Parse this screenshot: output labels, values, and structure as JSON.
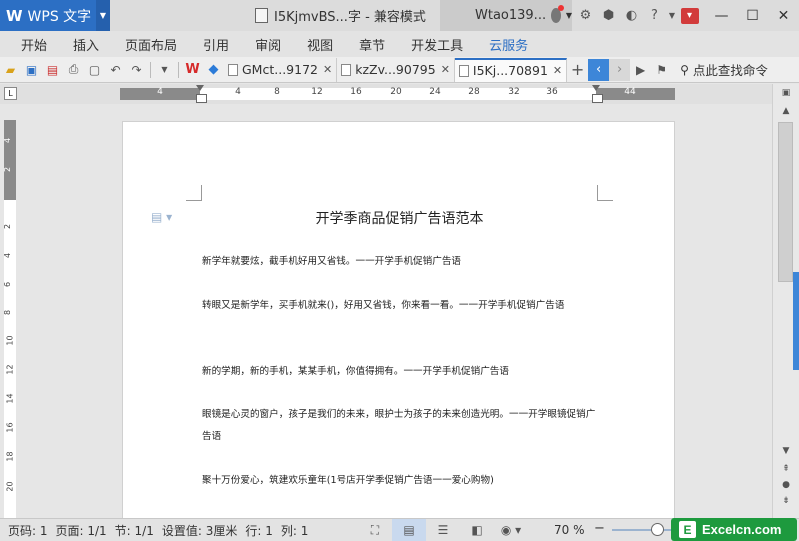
{
  "titlebar": {
    "app_logo": "W",
    "app_name": "WPS 文字",
    "doc_title": "I5KjmvBS...字 - 兼容模式",
    "user_name": "Wtao139..."
  },
  "menu": {
    "items": [
      "开始",
      "插入",
      "页面布局",
      "引用",
      "审阅",
      "视图",
      "章节",
      "开发工具",
      "云服务"
    ],
    "active_color": "#2c6fc4"
  },
  "tabs": [
    {
      "label": "GMct...9172"
    },
    {
      "label": "kzZv...90795"
    },
    {
      "label": "I5Kj...70891"
    }
  ],
  "search_command": "点此查找命令",
  "ruler": {
    "h_ticks": [
      "4",
      "4",
      "8",
      "12",
      "16",
      "20",
      "24",
      "28",
      "32",
      "36",
      "44"
    ],
    "v_ticks": [
      "4",
      "2",
      "2",
      "4",
      "6",
      "8",
      "10",
      "12",
      "14",
      "16",
      "18",
      "20"
    ]
  },
  "document": {
    "heading": "开学季商品促销广告语范本",
    "paragraphs": [
      "新学年就要炫，截手机好用又省钱。一一开学手机促销广告语",
      "转眼又是新学年，买手机就来()，好用又省钱，你来看一看。一一开学手机促销广告语",
      "新的学期，新的手机，某某手机，你值得拥有。一一开学手机促销广告语",
      "眼镜是心灵的窗户，孩子是我们的未来，眼护士为孩子的未来创造光明。一一开学眼镜促销广告语",
      "聚十万份爱心，筑建欢乐童年(1号店开学季促销广告语一一爱心购物)"
    ]
  },
  "statusbar": {
    "page_no": "页码: 1",
    "pages": "页面: 1/1",
    "section": "节: 1/1",
    "setting": "设置值: 3厘米",
    "row": "行: 1",
    "col": "列: 1",
    "zoom": "70 %",
    "zoom_level_percent": 70
  },
  "watermark": {
    "logo": "E",
    "text": "Excelcn.com",
    "color": "#1d9a3e"
  }
}
